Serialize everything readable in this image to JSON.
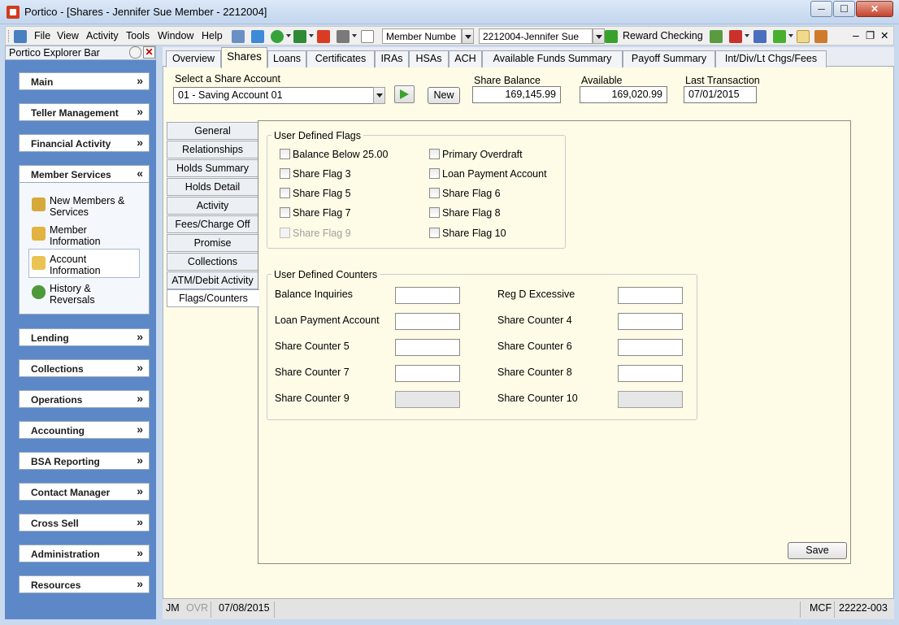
{
  "window": {
    "title": "Portico - [Shares - Jennifer Sue Member - 2212004]",
    "min_label": "─",
    "max_label": "☐",
    "close_label": "✕"
  },
  "menu": {
    "items": [
      "File",
      "View",
      "Activity",
      "Tools",
      "Window",
      "Help"
    ],
    "member_lookup_type": "Member Numbe",
    "member_lookup_value": "2212004-Jennifer Sue",
    "reward_label": "Reward Checking",
    "mdi_min": "–",
    "mdi_restore": "❐",
    "mdi_close": "✕"
  },
  "explorer": {
    "title": "Portico Explorer Bar",
    "close": "✕",
    "groups": [
      {
        "label": "Main",
        "chevron": "»"
      },
      {
        "label": "Teller Management",
        "chevron": "»"
      },
      {
        "label": "Financial Activity",
        "chevron": "»"
      },
      {
        "label": "Member Services",
        "chevron": "«"
      },
      {
        "label": "Lending",
        "chevron": "»"
      },
      {
        "label": "Collections",
        "chevron": "»"
      },
      {
        "label": "Operations",
        "chevron": "»"
      },
      {
        "label": "Accounting",
        "chevron": "»"
      },
      {
        "label": "BSA Reporting",
        "chevron": "»"
      },
      {
        "label": "Contact Manager",
        "chevron": "»"
      },
      {
        "label": "Cross Sell",
        "chevron": "»"
      },
      {
        "label": "Administration",
        "chevron": "»"
      },
      {
        "label": "Resources",
        "chevron": "»"
      }
    ],
    "member_services_items": [
      {
        "line1": "New Members &",
        "line2": "Services"
      },
      {
        "line1": "Member",
        "line2": "Information"
      },
      {
        "line1": "Account",
        "line2": "Information"
      },
      {
        "line1": "History &",
        "line2": "Reversals"
      }
    ]
  },
  "tabs": [
    "Overview",
    "Shares",
    "Loans",
    "Certificates",
    "IRAs",
    "HSAs",
    "ACH",
    "Available Funds Summary",
    "Payoff Summary",
    "Int/Div/Lt Chgs/Fees"
  ],
  "account": {
    "select_label": "Select a Share Account",
    "selected": "01 - Saving Account 01",
    "new_button": "New",
    "share_balance_label": "Share Balance",
    "share_balance": "169,145.99",
    "available_label": "Available",
    "available": "169,020.99",
    "last_transaction_label": "Last Transaction",
    "last_transaction": "07/01/2015"
  },
  "subtabs": [
    "General",
    "Relationships",
    "Holds Summary",
    "Holds Detail",
    "Activity",
    "Fees/Charge Off",
    "Promise",
    "Collections",
    "ATM/Debit Activity",
    "Flags/Counters"
  ],
  "flags": {
    "title": "User Defined Flags",
    "left": [
      {
        "label": "Balance Below 25.00",
        "enabled": true
      },
      {
        "label": "Share Flag 3",
        "enabled": true
      },
      {
        "label": "Share Flag 5",
        "enabled": true
      },
      {
        "label": "Share Flag 7",
        "enabled": true
      },
      {
        "label": "Share Flag 9",
        "enabled": false
      }
    ],
    "right": [
      {
        "label": "Primary Overdraft",
        "enabled": true
      },
      {
        "label": "Loan Payment Account",
        "enabled": true
      },
      {
        "label": "Share Flag 6",
        "enabled": true
      },
      {
        "label": "Share Flag 8",
        "enabled": true
      },
      {
        "label": "Share Flag 10",
        "enabled": true
      }
    ]
  },
  "counters": {
    "title": "User Defined Counters",
    "left": [
      {
        "label": "Balance Inquiries",
        "value": "",
        "enabled": true
      },
      {
        "label": "Loan Payment Account",
        "value": "",
        "enabled": true
      },
      {
        "label": "Share Counter 5",
        "value": "",
        "enabled": true
      },
      {
        "label": "Share Counter 7",
        "value": "",
        "enabled": true
      },
      {
        "label": "Share Counter 9",
        "value": "",
        "enabled": false
      }
    ],
    "right": [
      {
        "label": "Reg D Excessive",
        "value": "",
        "enabled": true
      },
      {
        "label": "Share Counter 4",
        "value": "",
        "enabled": true
      },
      {
        "label": "Share Counter 6",
        "value": "",
        "enabled": true
      },
      {
        "label": "Share Counter 8",
        "value": "",
        "enabled": true
      },
      {
        "label": "Share Counter 10",
        "value": "",
        "enabled": false
      }
    ]
  },
  "save_button": "Save",
  "status": {
    "user": "JM",
    "mode": "OVR",
    "date": "07/08/2015",
    "code": "MCF",
    "number": "22222-003"
  }
}
